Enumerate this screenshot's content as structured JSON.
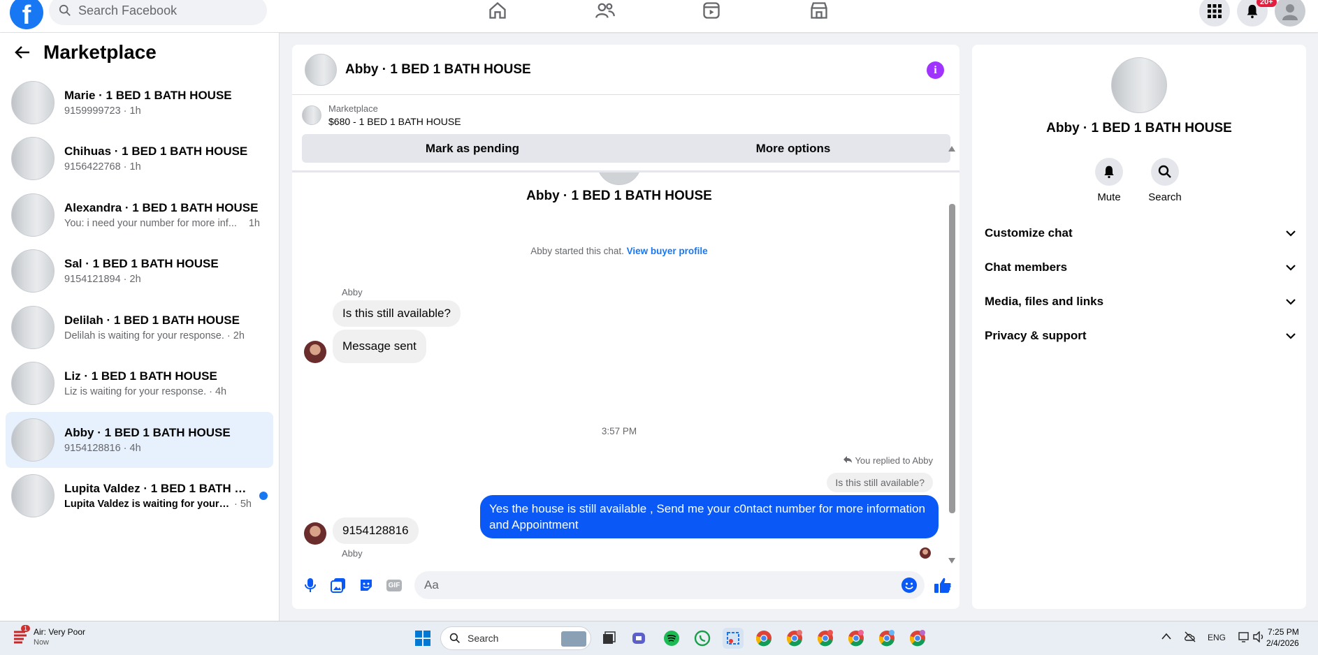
{
  "topbar": {
    "logo": "f",
    "search_placeholder": "Search Facebook",
    "notification_badge": "20+"
  },
  "left": {
    "title": "Marketplace",
    "conversations": [
      {
        "name": "Marie · 1 BED 1 BATH HOUSE",
        "sub": "9159999723 · 1h"
      },
      {
        "name": "Chihuas · 1 BED 1 BATH HOUSE",
        "sub": "9156422768 · 1h"
      },
      {
        "name": "Alexandra · 1 BED 1 BATH HOUSE",
        "sub": "You: i need your number for more inf...",
        "time": "1h"
      },
      {
        "name": "Sal · 1 BED 1 BATH HOUSE",
        "sub": "9154121894 · 2h"
      },
      {
        "name": "Delilah · 1 BED 1 BATH HOUSE",
        "sub": "Delilah is waiting for your response. · 2h"
      },
      {
        "name": "Liz · 1 BED 1 BATH HOUSE",
        "sub": "Liz is waiting for your response. · 4h"
      },
      {
        "name": "Abby · 1 BED 1 BATH HOUSE",
        "sub": "9154128816 · 4h"
      },
      {
        "name": "Lupita Valdez · 1 BED 1 BATH HO...",
        "sub": "Lupita Valdez is waiting for your re...",
        "time": "· 5h"
      }
    ]
  },
  "chat": {
    "title": "Abby · 1 BED 1 BATH HOUSE",
    "info_icon": "i",
    "listing_label": "Marketplace",
    "listing_title": "$680 - 1 BED 1 BATH HOUSE",
    "mark_pending": "Mark as pending",
    "more_options": "More options",
    "intro_name": "Abby · 1 BED 1 BATH HOUSE",
    "started_text": "Abby started this chat.",
    "buyer_link": "View buyer profile",
    "sender1": "Abby",
    "msg1": "Is this still available?",
    "msg2": "Message sent",
    "timestamp": "3:57 PM",
    "reply_note": "You replied to Abby",
    "reply_quote": "Is this still available?",
    "outgoing": "Yes the house is still available , Send me your c0ntact number for more information and Appointment",
    "sender2": "Abby",
    "msg3": "9154128816",
    "composer_placeholder": "Aa",
    "gif_label": "GIF"
  },
  "right": {
    "name": "Abby · 1 BED 1 BATH HOUSE",
    "mute": "Mute",
    "search": "Search",
    "sections": [
      "Customize chat",
      "Chat members",
      "Media, files and links",
      "Privacy & support"
    ]
  },
  "taskbar": {
    "weather_title": "Air: Very Poor",
    "weather_sub": "Now",
    "weather_badge": "1",
    "search": "Search",
    "lang": "ENG",
    "time": "7:25 PM",
    "date": "2/4/2026"
  },
  "colors": {
    "brand": "#1877f2",
    "outgoing_bubble": "#0a58f5",
    "active_row": "#e7f0fd",
    "info": "#a033ff"
  }
}
